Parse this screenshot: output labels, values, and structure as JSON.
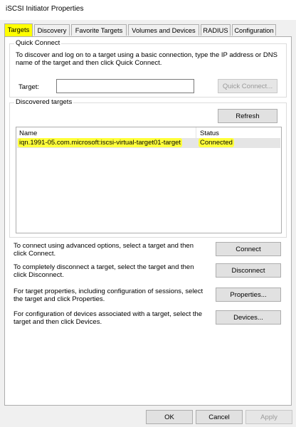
{
  "window": {
    "title": "iSCSI Initiator Properties"
  },
  "tabs": [
    {
      "label": "Targets",
      "active": true
    },
    {
      "label": "Discovery"
    },
    {
      "label": "Favorite Targets"
    },
    {
      "label": "Volumes and Devices"
    },
    {
      "label": "RADIUS"
    },
    {
      "label": "Configuration"
    }
  ],
  "quick_connect": {
    "group_label": "Quick Connect",
    "description": "To discover and log on to a target using a basic connection, type the IP address or DNS name of the target and then click Quick Connect.",
    "target_label": "Target:",
    "target_value": "",
    "button_label": "Quick Connect..."
  },
  "discovered": {
    "group_label": "Discovered targets",
    "refresh_label": "Refresh",
    "columns": [
      "Name",
      "Status"
    ],
    "rows": [
      {
        "name": "iqn.1991-05.com.microsoft:iscsi-virtual-target01-target",
        "status": "Connected"
      }
    ]
  },
  "actions": [
    {
      "text": "To connect using advanced options, select a target and then click Connect.",
      "button": "Connect"
    },
    {
      "text": "To completely disconnect a target, select the target and then click Disconnect.",
      "button": "Disconnect"
    },
    {
      "text": "For target properties, including configuration of sessions, select the target and click Properties.",
      "button": "Properties..."
    },
    {
      "text": "For configuration of devices associated with a target, select the target and then click Devices.",
      "button": "Devices..."
    }
  ],
  "footer": {
    "ok": "OK",
    "cancel": "Cancel",
    "apply": "Apply"
  },
  "colors": {
    "highlight": "#ffff00",
    "panel": "#ffffff",
    "chrome": "#f0f0f0"
  }
}
